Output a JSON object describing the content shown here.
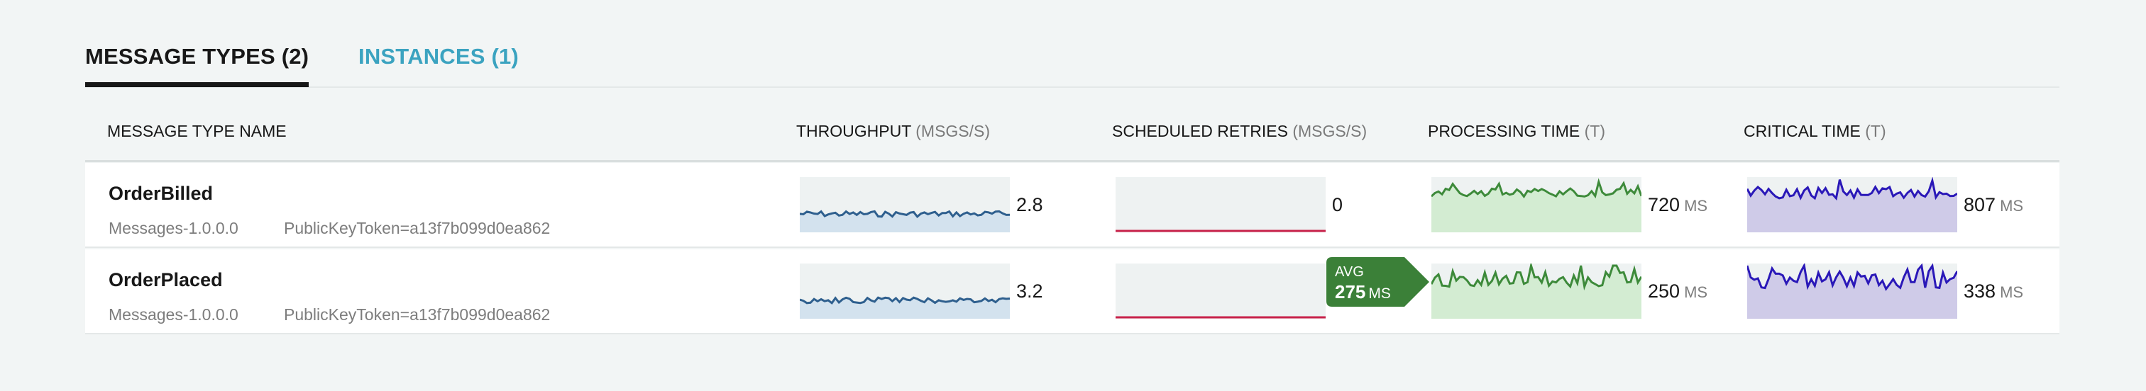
{
  "tabs": [
    {
      "label": "MESSAGE TYPES (2)",
      "active": true
    },
    {
      "label": "INSTANCES (1)",
      "active": false
    }
  ],
  "columns": {
    "name": {
      "label": "MESSAGE TYPE NAME",
      "unit": ""
    },
    "throughput": {
      "label": "THROUGHPUT",
      "unit": "(MSGS/S)"
    },
    "retries": {
      "label": "SCHEDULED RETRIES",
      "unit": "(MSGS/S)"
    },
    "processing": {
      "label": "PROCESSING TIME",
      "unit": "(T)"
    },
    "critical": {
      "label": "CRITICAL TIME",
      "unit": "(T)"
    }
  },
  "rows": [
    {
      "name": "OrderBilled",
      "version": "Messages-1.0.0.0",
      "token": "PublicKeyToken=a13f7b099d0ea862",
      "throughput": "2.8",
      "retries": "0",
      "processing": "720",
      "processing_unit": "MS",
      "critical": "807",
      "critical_unit": "MS"
    },
    {
      "name": "OrderPlaced",
      "version": "Messages-1.0.0.0",
      "token": "PublicKeyToken=a13f7b099d0ea862",
      "throughput": "3.2",
      "retries": "0",
      "processing": "250",
      "processing_unit": "MS",
      "critical": "338",
      "critical_unit": "MS"
    }
  ],
  "avg_tooltip": {
    "label": "AVG",
    "value": "275",
    "unit": "MS"
  },
  "colors": {
    "throughput_line": "#2e5f8e",
    "throughput_fill": "#d3e2ee",
    "retries_line": "#c8224a",
    "processing_line": "#3d8a3a",
    "processing_fill": "#d3ecd2",
    "critical_line": "#2a18b8",
    "critical_fill": "#cfcbe8",
    "spark_bg": "#eef2f2",
    "tooltip_bg": "#3b8038"
  }
}
